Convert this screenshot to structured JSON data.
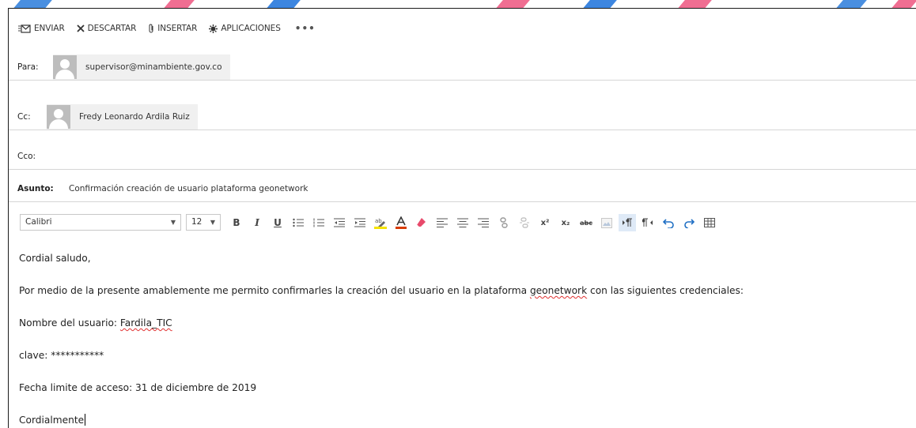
{
  "commands": {
    "send": "ENVIAR",
    "discard": "DESCARTAR",
    "insert": "INSERTAR",
    "apps": "APLICACIONES",
    "more": "•••"
  },
  "to": {
    "label": "Para:",
    "recipient": "supervisor@minambiente.gov.co"
  },
  "cc": {
    "label": "Cc:",
    "recipient": "Fredy Leonardo Ardila Ruiz"
  },
  "bcc": {
    "label": "Cco:"
  },
  "subject": {
    "label": "Asunto:",
    "value": "Confirmación creación de usuario plataforma geonetwork"
  },
  "format": {
    "font": "Calibri",
    "size": "12",
    "bold": "B",
    "italic": "I",
    "underline": "U",
    "superscript": "x²",
    "subscript": "x₂",
    "strikethrough": "abc"
  },
  "message": {
    "greeting": "Cordial saludo,",
    "intro_before": "Por medio de la presente amablemente me permito confirmarles la creación del usuario en la plataforma ",
    "intro_word": "geonetwork",
    "intro_after": " con las siguientes credenciales:",
    "username_label": "Nombre del usuario: ",
    "username_value": "Fardila_TIC",
    "password_line": "clave: ***********",
    "deadline_line": "Fecha limite de acceso: 31 de diciembre de 2019",
    "closing": "Cordialmente"
  },
  "colors": {
    "accent_blue": "#0078d7",
    "stripe_pink": "#f0557a",
    "highlight_yellow": "#f5e300",
    "font_color_red": "#d83b01"
  }
}
